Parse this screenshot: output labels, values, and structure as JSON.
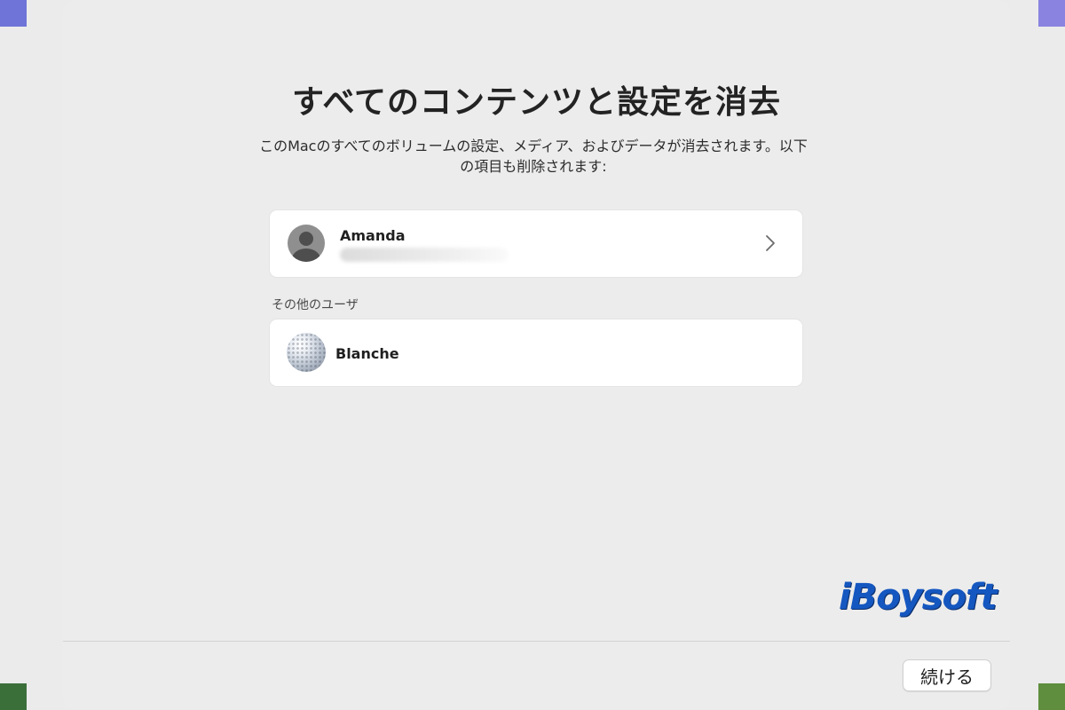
{
  "dialog": {
    "title": "すべてのコンテンツと設定を消去",
    "subtitle": "このMacのすべてのボリュームの設定、メディア、およびデータが消去されます。以下の項目も削除されます:"
  },
  "primary_user": {
    "name": "Amanda",
    "detail_icon": "chevron-right-icon",
    "avatar_icon": "default-user-avatar-icon"
  },
  "other_users": {
    "section_label": "その他のユーザ",
    "items": [
      {
        "name": "Blanche",
        "avatar_icon": "golf-ball-avatar-icon"
      }
    ]
  },
  "watermark": {
    "text": "iBoysoft"
  },
  "footer": {
    "continue_label": "続ける"
  },
  "colors": {
    "window_bg": "#ececec",
    "card_bg": "#ffffff",
    "logo_blue": "#1557c0"
  }
}
